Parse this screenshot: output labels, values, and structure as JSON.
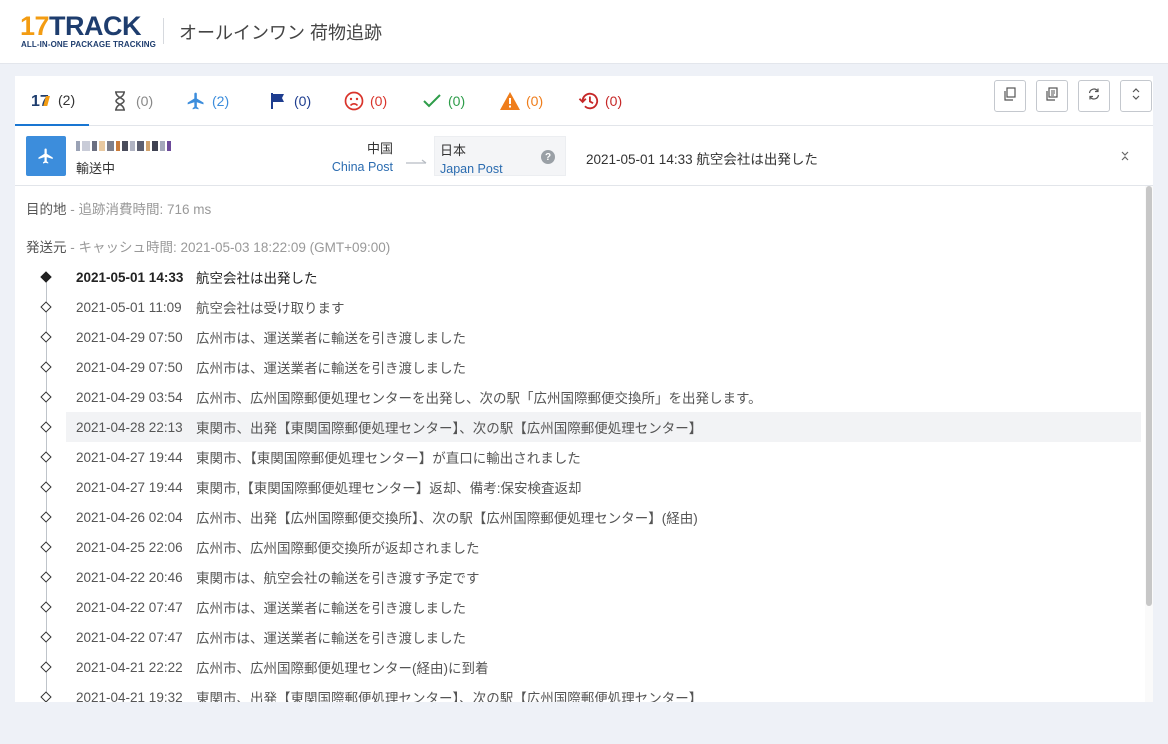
{
  "header": {
    "logo_number": "17",
    "logo_word": "TRACK",
    "logo_sub": "ALL-IN-ONE PACKAGE TRACKING",
    "title": "オールインワン 荷物追跡"
  },
  "tabs": [
    {
      "name": "all",
      "count": "(2)",
      "color": "#333333",
      "icon": "17track-icon"
    },
    {
      "name": "not-found",
      "count": "(0)",
      "color": "#888888",
      "icon": "hourglass-icon"
    },
    {
      "name": "in-transit",
      "count": "(2)",
      "color": "#3c8ddc",
      "icon": "airplane-icon"
    },
    {
      "name": "pickup",
      "count": "(0)",
      "color": "#1e3d8f",
      "icon": "flag-icon"
    },
    {
      "name": "undelivered",
      "count": "(0)",
      "color": "#d9342b",
      "icon": "sad-face-icon"
    },
    {
      "name": "delivered",
      "count": "(0)",
      "color": "#2e9d4a",
      "icon": "check-icon"
    },
    {
      "name": "alert",
      "count": "(0)",
      "color": "#ef7d1b",
      "icon": "warning-icon"
    },
    {
      "name": "expired",
      "count": "(0)",
      "color": "#c62828",
      "icon": "history-icon"
    }
  ],
  "summary": {
    "status": "輸送中",
    "origin_country": "中国",
    "origin_carrier": "China Post",
    "dest_country": "日本",
    "dest_carrier": "Japan Post",
    "latest_event": "2021-05-01 14:33  航空会社は出発した"
  },
  "meta": {
    "destination_label": "目的地",
    "tracking_time": "追跡消費時間: 716 ms",
    "origin_label": "発送元",
    "cache_time": "キャッシュ時間: 2021-05-03 18:22:09 (GMT+09:00)"
  },
  "events": [
    {
      "time": "2021-05-01 14:33",
      "desc": "航空会社は出発した"
    },
    {
      "time": "2021-05-01 11:09",
      "desc": "航空会社は受け取ります"
    },
    {
      "time": "2021-04-29 07:50",
      "desc": "広州市は、運送業者に輸送を引き渡しました"
    },
    {
      "time": "2021-04-29 07:50",
      "desc": "広州市は、運送業者に輸送を引き渡しました"
    },
    {
      "time": "2021-04-29 03:54",
      "desc": "広州市、広州国際郵便処理センターを出発し、次の駅「広州国際郵便交換所」を出発します。"
    },
    {
      "time": "2021-04-28 22:13",
      "desc": "東関市、出発【東関国際郵便処理センター】、次の駅【広州国際郵便処理センター】"
    },
    {
      "time": "2021-04-27 19:44",
      "desc": "東関市、【東関国際郵便処理センター】が直口に輸出されました"
    },
    {
      "time": "2021-04-27 19:44",
      "desc": "東関市,【東関国際郵便処理センター】返却、備考:保安検査返却"
    },
    {
      "time": "2021-04-26 02:04",
      "desc": "広州市、出発【広州国際郵便交換所】、次の駅【広州国際郵便処理センター】(経由)"
    },
    {
      "time": "2021-04-25 22:06",
      "desc": "広州市、広州国際郵便交換所が返却されました"
    },
    {
      "time": "2021-04-22 20:46",
      "desc": "東関市は、航空会社の輸送を引き渡す予定です"
    },
    {
      "time": "2021-04-22 07:47",
      "desc": "広州市は、運送業者に輸送を引き渡しました"
    },
    {
      "time": "2021-04-22 07:47",
      "desc": "広州市は、運送業者に輸送を引き渡しました"
    },
    {
      "time": "2021-04-21 22:22",
      "desc": "広州市、広州国際郵便処理センター(経由)に到着"
    },
    {
      "time": "2021-04-21 19:32",
      "desc": "東関市、出発【東関国際郵便処理センター】、次の駅【広州国際郵便処理センター】"
    }
  ],
  "colors": {
    "accent": "#1976d2",
    "status_blue": "#3c8ddc",
    "carrier_link": "#2b6cb0"
  }
}
